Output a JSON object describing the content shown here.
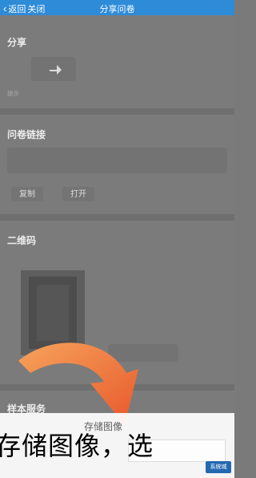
{
  "header": {
    "back_label": "返回",
    "close_label": "关闭",
    "title": "分享问卷"
  },
  "share": {
    "title": "分享",
    "hint_prefix": "提示"
  },
  "link": {
    "title": "问卷链接",
    "copy_label": "复制",
    "open_label": "打开"
  },
  "qrcode": {
    "title": "二维码"
  },
  "template": {
    "title": "样本服务"
  },
  "overlay": {
    "save_label": "存储图像",
    "caption": "存储图像，选"
  },
  "watermark": {
    "text": "系统城"
  }
}
